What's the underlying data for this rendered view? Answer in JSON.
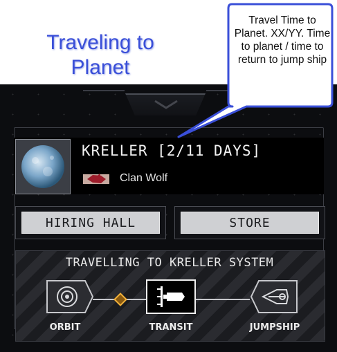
{
  "annotation": {
    "title": "Traveling to Planet",
    "callout": "Travel Time to Planet. XX/YY.  Time to planet / time to return to jump ship"
  },
  "planet": {
    "name": "KRELLER [2/11 DAYS]",
    "faction": "Clan Wolf"
  },
  "buttons": {
    "hiring_hall": "HIRING HALL",
    "store": "STORE"
  },
  "travel": {
    "title": "TRAVELLING TO KRELLER SYSTEM",
    "stages": [
      {
        "label": "ORBIT",
        "icon": "orbit-icon",
        "active": false
      },
      {
        "label": "TRANSIT",
        "icon": "transit-icon",
        "active": true
      },
      {
        "label": "JUMPSHIP",
        "icon": "jumpship-icon",
        "active": false
      }
    ],
    "progress_marker_color": "#f0b03a"
  },
  "colors": {
    "annotation_title": "#3a4fd8",
    "callout_border": "#3a4fd8",
    "panel_bg": "#0c0d10",
    "button_bg": "#cfd0d3"
  }
}
